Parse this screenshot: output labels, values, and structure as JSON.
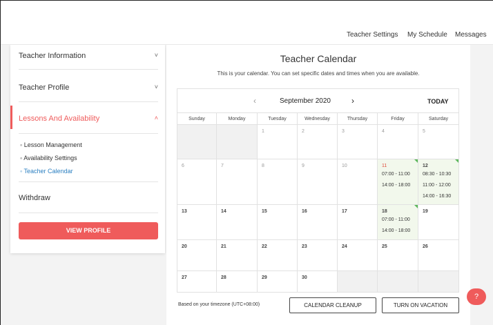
{
  "top_nav": [
    "Teacher Settings",
    "My Schedule",
    "Messages"
  ],
  "sidebar": {
    "sections": [
      {
        "label": "Teacher Information",
        "chevron": "˅"
      },
      {
        "label": "Teacher Profile",
        "chevron": "˅"
      },
      {
        "label": "Lessons And Availability",
        "chevron": "˄"
      },
      {
        "label": "Withdraw"
      }
    ],
    "sub_items": [
      "Lesson Management",
      "Availability Settings",
      "Teacher Calendar"
    ],
    "view_profile": "VIEW PROFILE",
    "accent": "#ef5b5b"
  },
  "calendar": {
    "title": "Teacher Calendar",
    "description": "This is your calendar. You can set specific dates and times when you are available.",
    "prev": "‹",
    "month": "September 2020",
    "next": "›",
    "today": "TODAY",
    "days_of_week": [
      "Sunday",
      "Monday",
      "Tuesday",
      "Wednesday",
      "Thursday",
      "Friday",
      "Saturday"
    ],
    "weeks": [
      [
        {
          "d": "",
          "grey": true
        },
        {
          "d": "",
          "grey": true
        },
        {
          "d": "1",
          "cur": false
        },
        {
          "d": "2",
          "cur": false
        },
        {
          "d": "3",
          "cur": false
        },
        {
          "d": "4",
          "cur": false
        },
        {
          "d": "5",
          "cur": false
        }
      ],
      [
        {
          "d": "6",
          "cur": false
        },
        {
          "d": "7",
          "cur": false
        },
        {
          "d": "8",
          "cur": false
        },
        {
          "d": "9",
          "cur": false
        },
        {
          "d": "10",
          "cur": false
        },
        {
          "d": "11",
          "cur": false,
          "avail": true,
          "red": true,
          "slots": [
            "07:00 - 11:00",
            "14:00 - 18:00"
          ]
        },
        {
          "d": "12",
          "cur": true,
          "avail": true,
          "slots": [
            "08:30 - 10:30",
            "11:00 - 12:00",
            "14:00 - 16:30"
          ]
        }
      ],
      [
        {
          "d": "13",
          "cur": true
        },
        {
          "d": "14",
          "cur": true
        },
        {
          "d": "15",
          "cur": true
        },
        {
          "d": "16",
          "cur": true
        },
        {
          "d": "17",
          "cur": true
        },
        {
          "d": "18",
          "cur": true,
          "avail": true,
          "slots": [
            "07:00 - 11:00",
            "14:00 - 18:00"
          ]
        },
        {
          "d": "19",
          "cur": true
        }
      ],
      [
        {
          "d": "20",
          "cur": true
        },
        {
          "d": "21",
          "cur": true
        },
        {
          "d": "22",
          "cur": true
        },
        {
          "d": "23",
          "cur": true
        },
        {
          "d": "24",
          "cur": true
        },
        {
          "d": "25",
          "cur": true
        },
        {
          "d": "26",
          "cur": true
        }
      ],
      [
        {
          "d": "27",
          "cur": true
        },
        {
          "d": "28",
          "cur": true
        },
        {
          "d": "29",
          "cur": true
        },
        {
          "d": "30",
          "cur": true
        },
        {
          "d": "",
          "grey": true
        },
        {
          "d": "",
          "grey": true
        },
        {
          "d": "",
          "grey": true
        }
      ]
    ],
    "timezone_note": "Based on your timezone (UTC+08:00)",
    "cleanup_button": "CALENDAR CLEANUP",
    "vacation_button": "TURN ON VACATION"
  },
  "help_icon": "?"
}
